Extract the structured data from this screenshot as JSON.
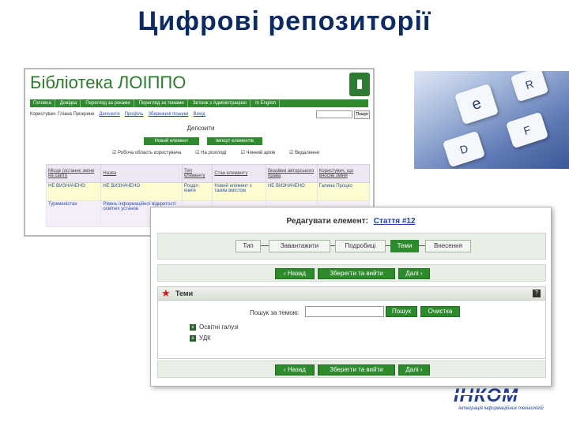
{
  "slide": {
    "title": "Цифрові репозиторії"
  },
  "library": {
    "title": "Бібліотека ЛОІППО",
    "nav": [
      "Головна",
      "Довідка",
      "Перегляд за роками",
      "Перегляд за темами",
      "Зв'язок з Адміністрацією",
      "In English"
    ],
    "subnav": {
      "user_label": "Користувач: Гліана Прокрине",
      "links": [
        "Депозити",
        "Профіль",
        "Збережені пошуки",
        "Вихід"
      ],
      "search_button": "Пошук"
    },
    "deposits_title": "Депозити",
    "buttons": [
      "Новий елемент",
      "Імпорт елементів"
    ],
    "options": [
      "Робоча область користувача",
      "На розгляді",
      "Чинний архів",
      "Видалення"
    ],
    "table": {
      "headers": [
        "Місце (останнє зміни на сайті)",
        "Назва",
        "Тип елементу",
        "Стан елементу",
        "Вказівки авторського права",
        "Користувач, що вносив зміни"
      ],
      "rows": [
        [
          "НЕ ВИЗНАЧЕНО",
          "НЕ ВИЗНАЧЕНО",
          "Розділ книги",
          "Новий елемент з таким вмістом",
          "НЕ ВИЗНАЧЕНО",
          "Галина Процко"
        ],
        [
          "Туркменістан",
          "Рівень інформаційної відкритості освітніх установ",
          "",
          "",
          "",
          ""
        ]
      ]
    }
  },
  "editor": {
    "heading_prefix": "Редагувати елемент:",
    "heading_link": "Стаття #12",
    "steps": [
      "Тип",
      "Завантажити",
      "Подробиці",
      "Теми",
      "Внесення"
    ],
    "active_step": "Теми",
    "nav": {
      "back": "‹ Назад",
      "save": "Зберегти та вийти",
      "next": "Далі ›"
    },
    "themes": {
      "title": "Теми",
      "help": "?",
      "search_label": "Пошук за темою:",
      "search_value": "",
      "search_button": "Пошук",
      "clear_button": "Очистка",
      "tree": [
        "Освітні галузі",
        "УДК"
      ]
    }
  },
  "keyboard": {
    "keys": [
      "e",
      "R",
      "D",
      "F"
    ]
  },
  "logo": {
    "text": "ІНКОМ",
    "subtitle": "інтеграція інформаційних технологій"
  },
  "colors": {
    "title": "#0c2b63",
    "accent_green": "#2d8a2d",
    "link": "#1d3fb0"
  }
}
